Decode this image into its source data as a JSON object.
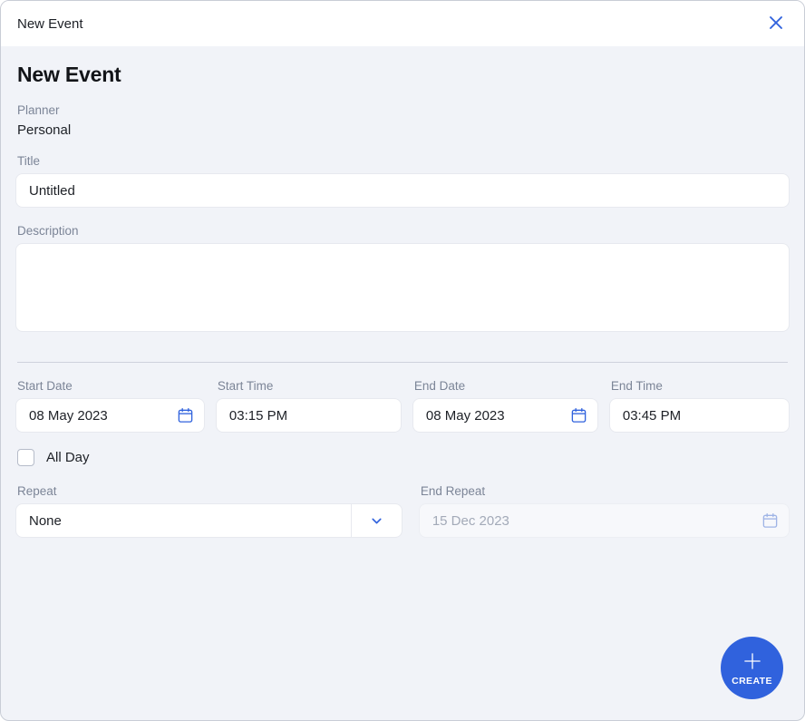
{
  "window": {
    "title": "New Event",
    "close_icon": "close-icon"
  },
  "heading": "New Event",
  "fields": {
    "planner": {
      "label": "Planner",
      "value": "Personal"
    },
    "title": {
      "label": "Title",
      "value": "Untitled",
      "placeholder": "Untitled"
    },
    "description": {
      "label": "Description",
      "value": "",
      "placeholder": ""
    },
    "start_date": {
      "label": "Start Date",
      "value": "08 May 2023",
      "icon": "calendar-icon"
    },
    "start_time": {
      "label": "Start Time",
      "value": "03:15 PM"
    },
    "end_date": {
      "label": "End Date",
      "value": "08 May 2023",
      "icon": "calendar-icon"
    },
    "end_time": {
      "label": "End Time",
      "value": "03:45 PM"
    },
    "all_day": {
      "label": "All Day",
      "checked": false
    },
    "repeat": {
      "label": "Repeat",
      "value": "None",
      "options": [
        "None"
      ],
      "arrow_icon": "chevron-down-icon"
    },
    "end_repeat": {
      "label": "End Repeat",
      "value": "",
      "placeholder": "15 Dec 2023",
      "icon": "calendar-icon",
      "disabled": true
    }
  },
  "actions": {
    "create": {
      "label": "CREATE",
      "icon": "plus-icon"
    }
  },
  "colors": {
    "accent": "#3062dd",
    "background": "#f1f3f8",
    "surface": "#ffffff",
    "label_text": "#7c8597",
    "body_text": "#1d2026",
    "disabled_text": "#a3aab8"
  }
}
